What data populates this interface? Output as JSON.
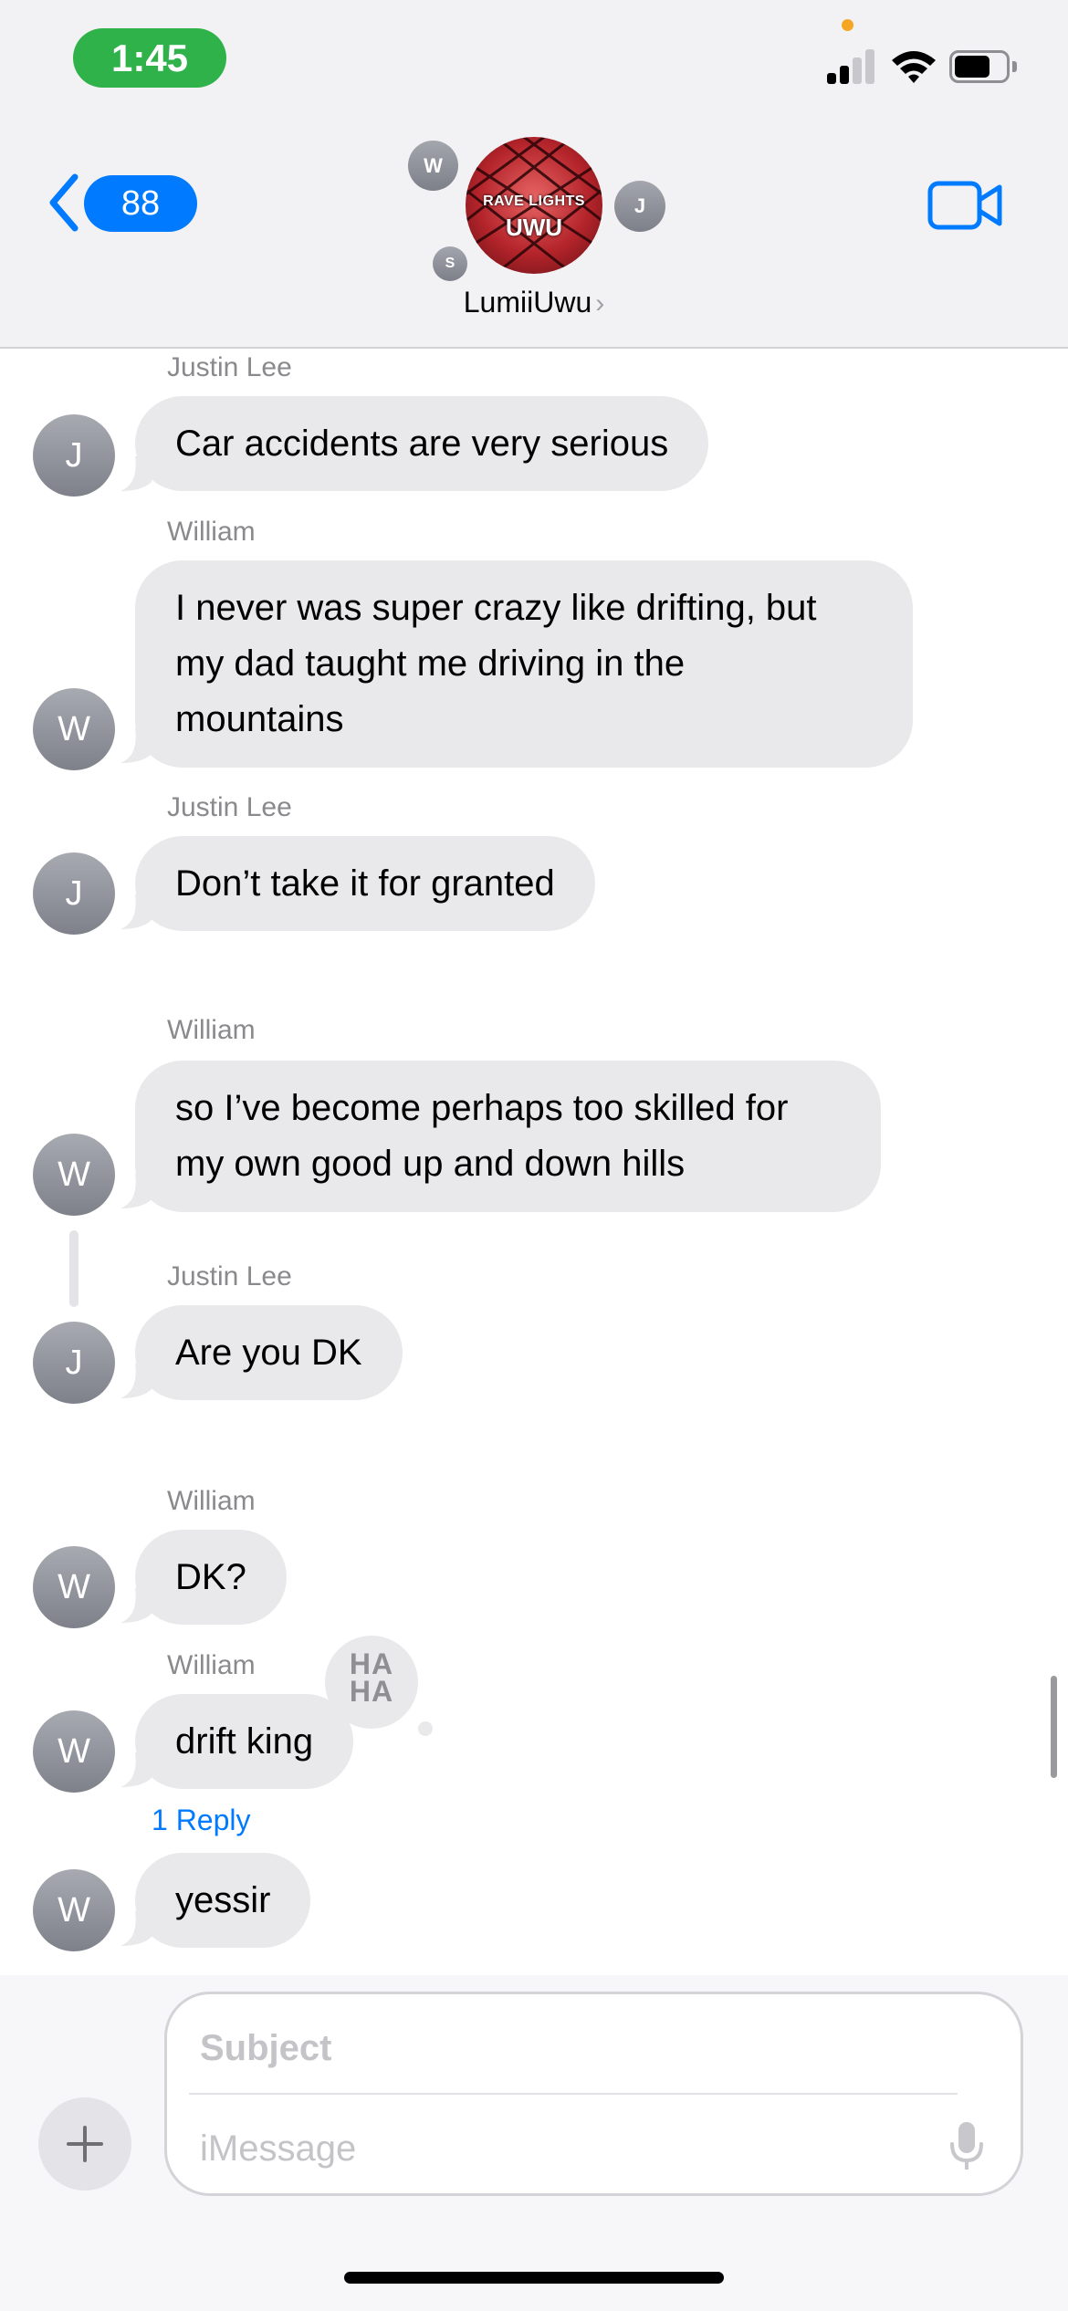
{
  "status_bar": {
    "time": "1:45",
    "signal_icon": "cellular-signal-icon",
    "wifi_icon": "wifi-icon",
    "battery_icon": "battery-icon"
  },
  "header": {
    "back_badge": "88",
    "group_name": "LumiiUwu",
    "name_arrow": "›",
    "avatar_text_line1": "RAVE LIGHTS",
    "avatar_text_line2": "UWU",
    "member_initials": [
      "W",
      "J",
      "S"
    ],
    "video_icon": "video-camera-icon"
  },
  "thread": {
    "messages": [
      {
        "sender": "Justin Lee",
        "initial": "J",
        "text": "Car accidents are very serious"
      },
      {
        "sender": "William",
        "initial": "W",
        "lines": [
          "I never was super crazy like drifting, but",
          "my dad taught me driving in the",
          "mountains"
        ]
      },
      {
        "sender": "Justin Lee",
        "initial": "J",
        "text": "Don’t take it for granted"
      },
      {
        "sender": "William",
        "initial": "W",
        "lines": [
          "so I’ve become perhaps too skilled for",
          "my own good up and down hills"
        ]
      },
      {
        "sender": "Justin Lee",
        "initial": "J",
        "text": "Are you DK"
      },
      {
        "sender": "William",
        "initial": "W",
        "text": "DK?"
      },
      {
        "sender": "William",
        "initial": "W",
        "text": "drift king",
        "tapback": "HA HA"
      },
      {
        "initial": "W",
        "text": "yessir"
      }
    ],
    "reply_link": "1 Reply",
    "tapback_label": [
      "HA",
      "HA"
    ]
  },
  "composer": {
    "subject_placeholder": "Subject",
    "message_placeholder": "iMessage",
    "plus_icon": "plus-icon",
    "mic_icon": "microphone-icon"
  },
  "colors": {
    "accent": "#007aff",
    "bubble_gray": "#e9e9eb",
    "time_pill": "#2fb24a"
  }
}
